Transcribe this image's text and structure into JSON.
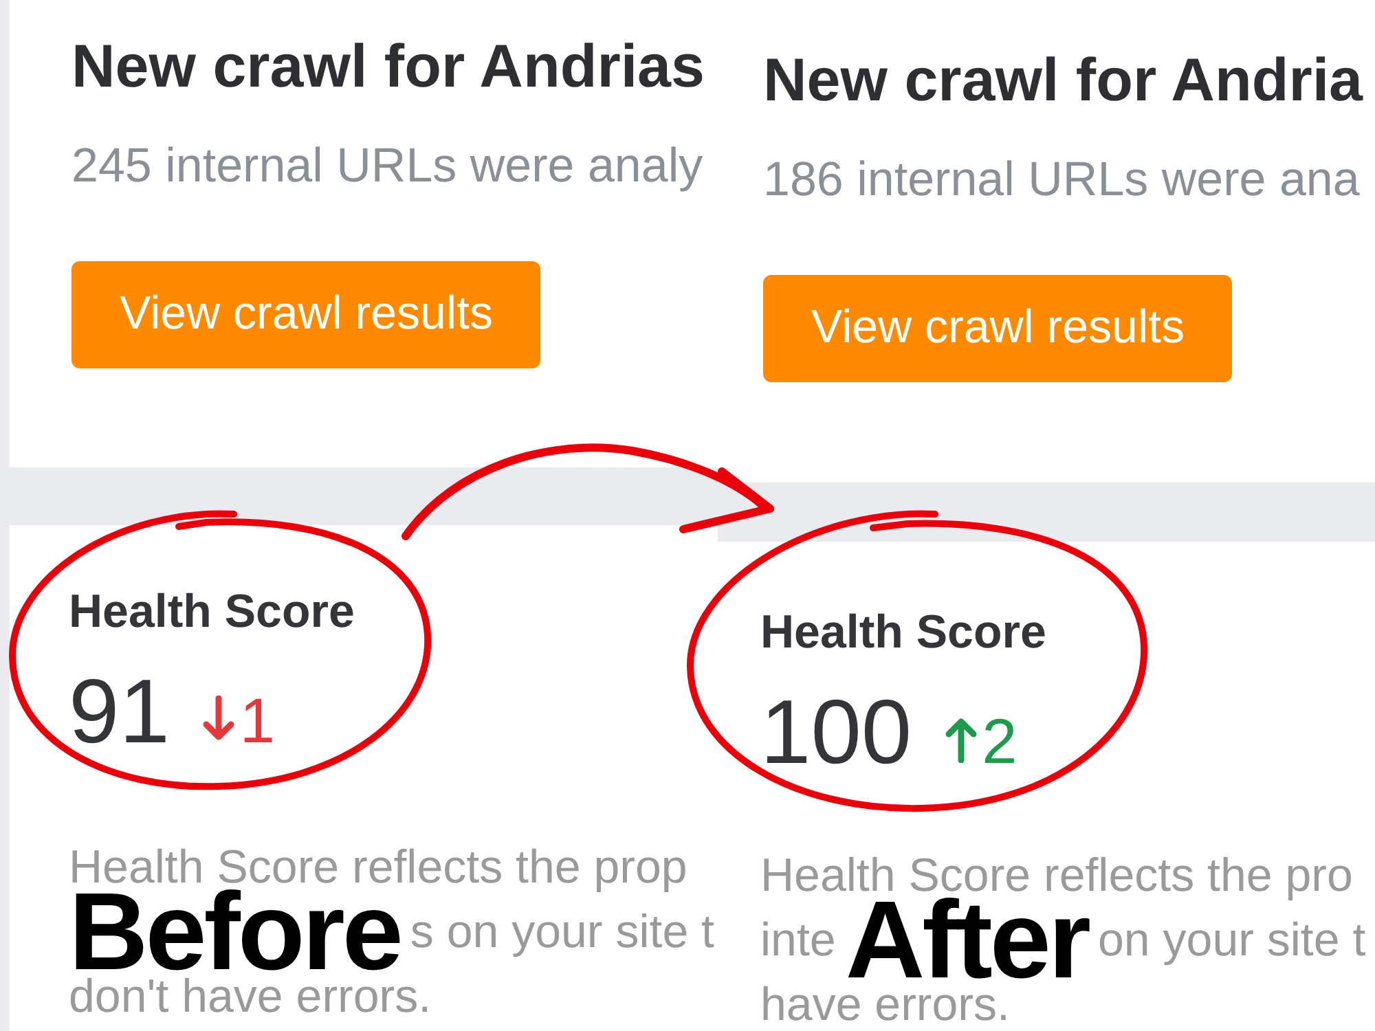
{
  "panels": [
    {
      "crawl": {
        "title": "New crawl for Andrias",
        "summary": "245 internal URLs were analy",
        "button": "View crawl results"
      },
      "health": {
        "title": "Health Score",
        "score": "91",
        "change": {
          "increase": false,
          "value": "1"
        }
      },
      "description_lines": [
        {
          "segments": [
            {
              "kind": "text",
              "text": "Health Score reflects the prop"
            }
          ]
        },
        {
          "segments": [
            {
              "kind": "overlay_label",
              "text": "Before"
            },
            {
              "kind": "text",
              "text": "s on your site t"
            }
          ]
        },
        {
          "segments": [
            {
              "kind": "text",
              "text": "don't have errors."
            }
          ]
        }
      ]
    },
    {
      "crawl": {
        "title": "New crawl for Andria",
        "summary": "186 internal URLs were ana",
        "button": "View crawl results"
      },
      "health": {
        "title": "Health Score",
        "score": "100",
        "change": {
          "increase": true,
          "value": "2"
        }
      },
      "description_lines": [
        {
          "segments": [
            {
              "kind": "text",
              "text": "Health Score reflects the pro"
            }
          ]
        },
        {
          "segments": [
            {
              "kind": "text",
              "text": "inte"
            },
            {
              "kind": "overlay_label",
              "text": "After"
            },
            {
              "kind": "text",
              "text": "on your site t"
            }
          ]
        },
        {
          "segments": [
            {
              "kind": "text",
              "text": "have errors."
            }
          ]
        }
      ]
    }
  ]
}
